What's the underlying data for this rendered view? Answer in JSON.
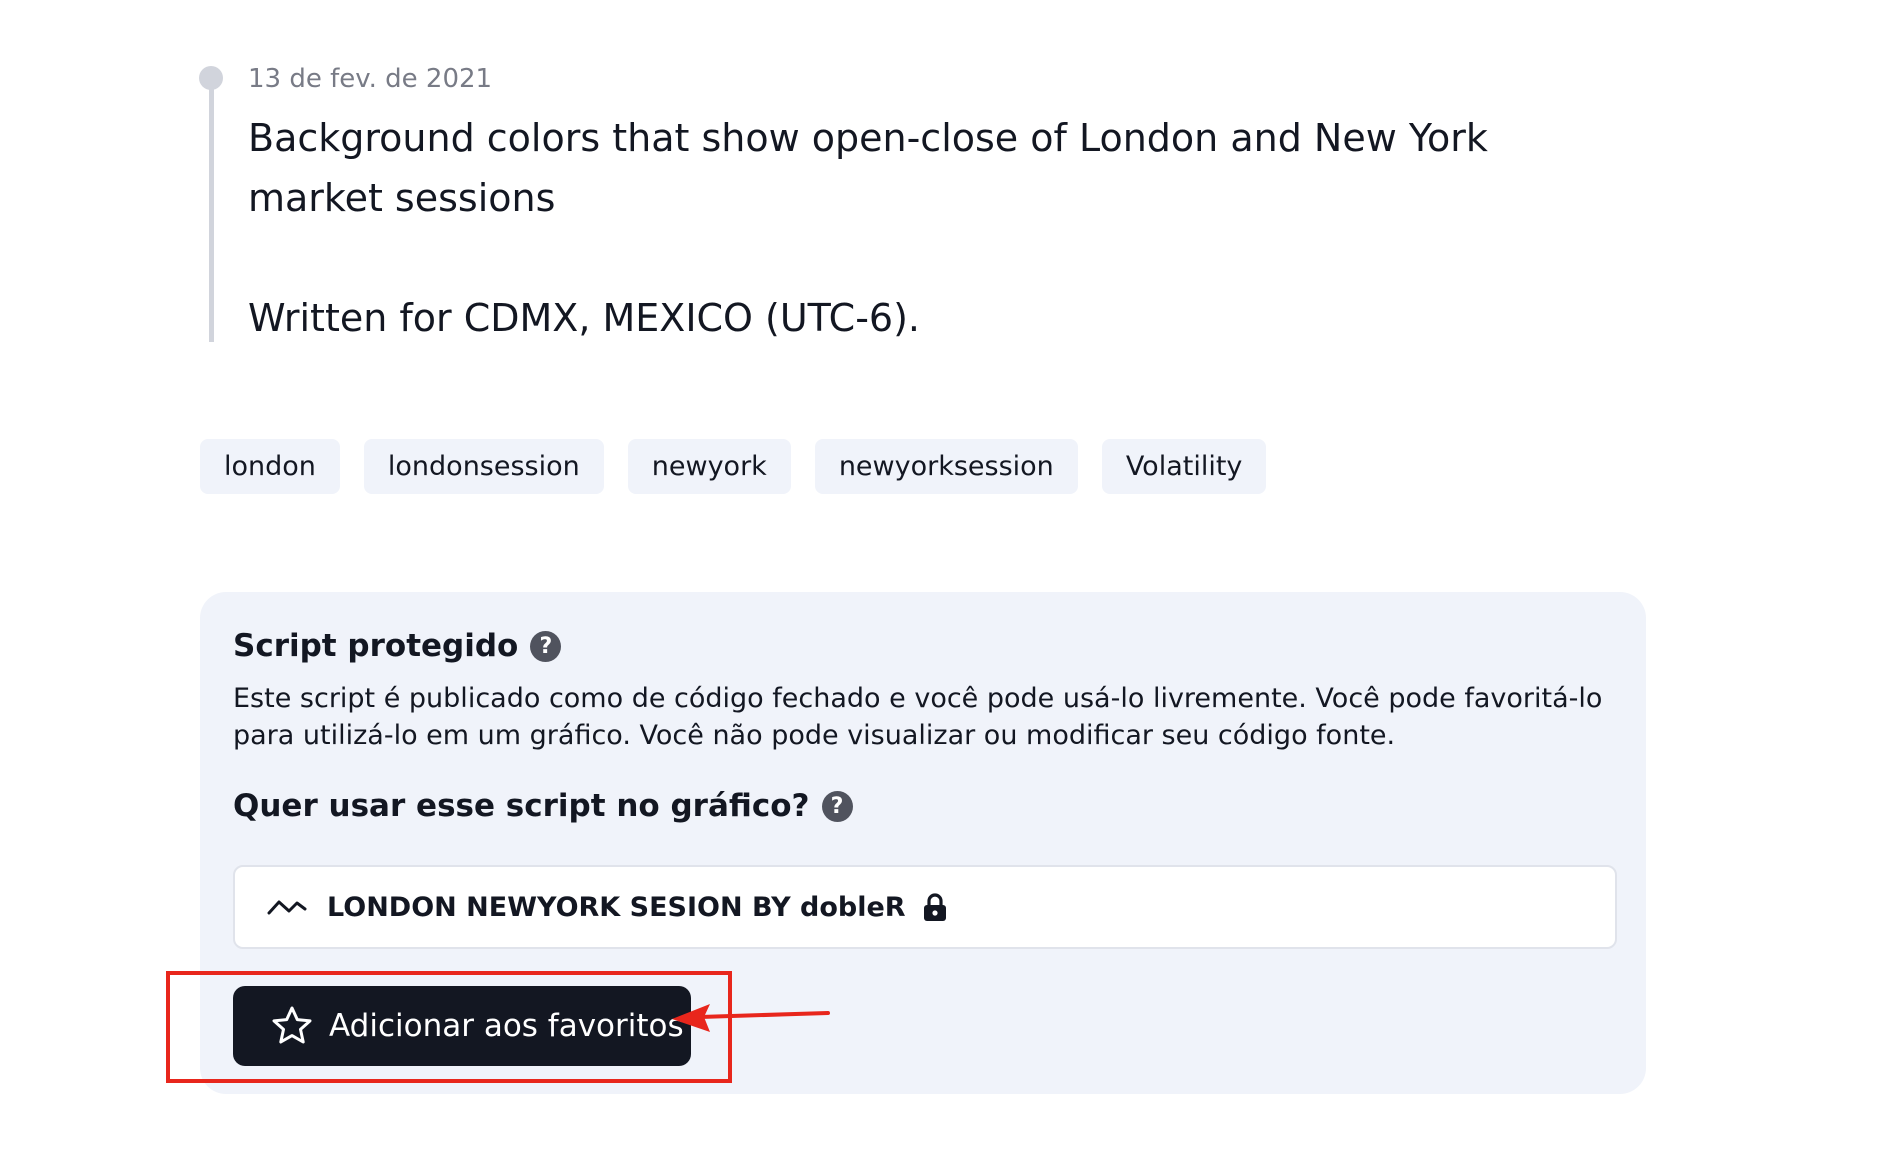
{
  "timeline": {
    "date": "13 de fev. de 2021",
    "paragraphs": [
      "Background colors that show open-close of London and New York market sessions",
      "Written for CDMX, MEXICO (UTC-6)."
    ]
  },
  "tags": [
    "london",
    "londonsession",
    "newyork",
    "newyorksession",
    "Volatility"
  ],
  "protected_script": {
    "heading": "Script protegido",
    "help_symbol": "?",
    "description": "Este script é publicado como de código fechado e você pode usá-lo livremente. Você pode favoritá-lo para utilizá-lo em um gráfico. Você não pode visualizar ou modificar seu código fonte.",
    "use_heading": "Quer usar esse script no gráfico?",
    "script_name": "LONDON NEWYORK SESION BY dobleR",
    "script_icon": "indicator-wave-icon",
    "lock_icon": "lock-icon",
    "favorite_button_label": "Adicionar aos favoritos",
    "favorite_icon": "star-icon"
  },
  "colors": {
    "card_background": "#f0f3fa",
    "button_background": "#131722",
    "annotation": "#e8261c",
    "timeline": "#d1d4dc"
  }
}
